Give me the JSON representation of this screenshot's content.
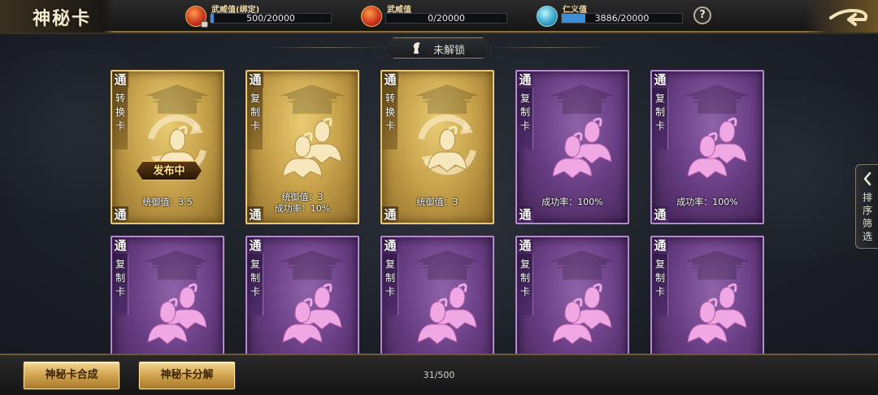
{
  "header": {
    "title": "神秘卡",
    "resources": [
      {
        "label": "武威值(绑定)",
        "value": "500/20000",
        "icon": "flame-coin-icon",
        "locked": true,
        "fill": 0.025
      },
      {
        "label": "武威值",
        "value": "0/20000",
        "icon": "flame-coin-icon",
        "locked": false,
        "fill": 0.0
      },
      {
        "label": "仁义值",
        "value": "3886/20000",
        "icon": "jade-orb-icon",
        "locked": false,
        "fill": 0.194
      }
    ],
    "help_label": "?"
  },
  "section": {
    "title": "未解锁",
    "icon": "horse-icon"
  },
  "cards": [
    {
      "grade": "通",
      "type": "转换卡",
      "variant": "gold",
      "art": "convert",
      "stats": [
        "统御值：3.5"
      ],
      "ribbon": "发布中"
    },
    {
      "grade": "通",
      "type": "复制卡",
      "variant": "gold",
      "art": "copy",
      "stats": [
        "统御值：3",
        "成功率：10%"
      ],
      "ribbon": ""
    },
    {
      "grade": "通",
      "type": "转换卡",
      "variant": "gold",
      "art": "convert",
      "stats": [
        "统御值：3"
      ],
      "ribbon": ""
    },
    {
      "grade": "通",
      "type": "复制卡",
      "variant": "purple",
      "art": "copy",
      "stats": [
        "成功率：100%"
      ],
      "ribbon": ""
    },
    {
      "grade": "通",
      "type": "复制卡",
      "variant": "purple",
      "art": "copy",
      "stats": [
        "成功率：100%"
      ],
      "ribbon": ""
    },
    {
      "grade": "通",
      "type": "复制卡",
      "variant": "purple",
      "art": "copy",
      "stats": [],
      "ribbon": ""
    },
    {
      "grade": "通",
      "type": "复制卡",
      "variant": "purple",
      "art": "copy",
      "stats": [],
      "ribbon": ""
    },
    {
      "grade": "通",
      "type": "复制卡",
      "variant": "purple",
      "art": "copy",
      "stats": [],
      "ribbon": ""
    },
    {
      "grade": "通",
      "type": "复制卡",
      "variant": "purple",
      "art": "copy",
      "stats": [],
      "ribbon": ""
    },
    {
      "grade": "通",
      "type": "复制卡",
      "variant": "purple",
      "art": "copy",
      "stats": [],
      "ribbon": ""
    }
  ],
  "side_tab": {
    "label": "排序筛选"
  },
  "footer": {
    "synthesize_label": "神秘卡合成",
    "decompose_label": "神秘卡分解",
    "count": "31/500"
  },
  "colors": {
    "gold_card": "#c9a44c",
    "purple_card": "#6a3f85",
    "accent_gold": "#e6c97a",
    "resource_bar": "#3c8fd6"
  }
}
